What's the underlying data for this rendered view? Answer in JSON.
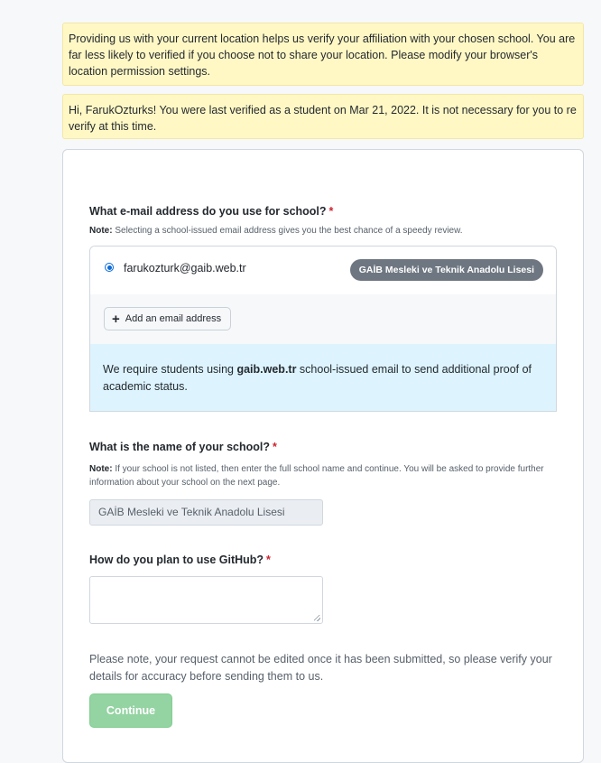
{
  "alerts": {
    "location": "Providing us with your current location helps us verify your affiliation with your chosen school. You are far less likely to verified if you choose not to share your location. Please modify your browser's location permission settings.",
    "verified": "Hi, FarukOzturks! You were last verified as a student on Mar 21, 2022. It is not necessary for you to re verify at this time."
  },
  "email_section": {
    "question": "What e-mail address do you use for school?",
    "required_mark": "*",
    "note_label": "Note:",
    "note_text": "Selecting a school-issued email address gives you the best chance of a speedy review.",
    "selected_email": "farukozturk@gaib.web.tr",
    "school_badge": "GAİB Mesleki ve Teknik Anadolu Lisesi",
    "add_email_label": "Add an email address",
    "info_prefix": "We require students using ",
    "info_domain": "gaib.web.tr",
    "info_suffix": " school-issued email to send additional proof of academic status."
  },
  "school_section": {
    "question": "What is the name of your school?",
    "required_mark": "*",
    "note_label": "Note:",
    "note_text": "If your school is not listed, then enter the full school name and continue. You will be asked to provide further information about your school on the next page.",
    "school_value": "GAİB Mesleki ve Teknik Anadolu Lisesi"
  },
  "usage_section": {
    "question": "How do you plan to use GitHub?",
    "required_mark": "*",
    "value": ""
  },
  "footer": {
    "final_note": "Please note, your request cannot be edited once it has been submitted, so please verify your details for accuracy before sending them to us.",
    "continue_label": "Continue"
  },
  "colors": {
    "flash_bg": "#fff8c5",
    "info_bg": "#ddf4ff",
    "badge_bg": "#6e7781",
    "continue_bg": "#94d3a2",
    "required": "#cf222e",
    "radio": "#0969da"
  }
}
